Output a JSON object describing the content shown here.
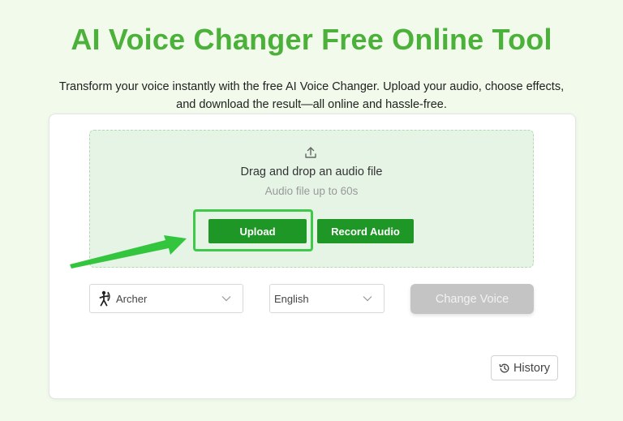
{
  "header": {
    "title": "AI Voice Changer Free Online Tool",
    "subtitle_line1": "Transform your voice instantly with the free AI Voice Changer. Upload your audio, choose effects,",
    "subtitle_line2": "and download the result—all online and hassle-free."
  },
  "dropzone": {
    "icon": "upload-icon",
    "title": "Drag and drop an audio file",
    "hint": "Audio file up to 60s",
    "upload_label": "Upload",
    "record_label": "Record Audio"
  },
  "controls": {
    "voice_selected": "Archer",
    "voice_icon": "archer-icon",
    "language_selected": "English",
    "change_voice_label": "Change Voice",
    "history_label": "History",
    "history_icon": "history-icon"
  },
  "colors": {
    "accent": "#4bb13a",
    "button_green": "#1f9727",
    "highlight_green": "#3ec94a",
    "disabled_gray": "#c4c4c4",
    "background": "#f1faeb"
  }
}
